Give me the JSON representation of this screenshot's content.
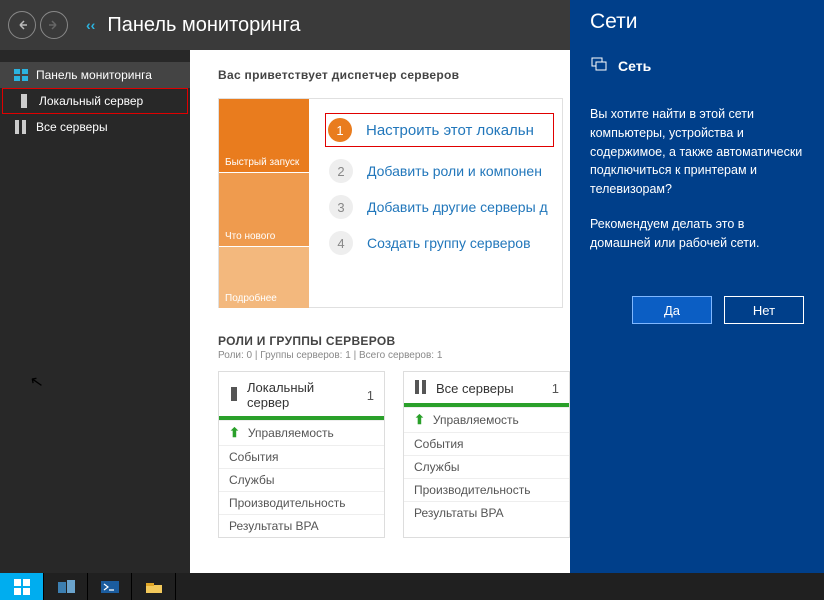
{
  "titlebar": {
    "title": "Панель мониторинга"
  },
  "sidebar": {
    "items": [
      {
        "label": "Панель мониторинга"
      },
      {
        "label": "Локальный сервер"
      },
      {
        "label": "Все серверы"
      }
    ]
  },
  "welcome": {
    "header": "Вас приветствует диспетчер серверов",
    "tabs": [
      {
        "label": "Быстрый запуск"
      },
      {
        "label": "Что нового"
      },
      {
        "label": "Подробнее"
      }
    ],
    "steps": [
      {
        "n": "1",
        "label": "Настроить этот локальн"
      },
      {
        "n": "2",
        "label": "Добавить роли и компонен"
      },
      {
        "n": "3",
        "label": "Добавить другие серверы д"
      },
      {
        "n": "4",
        "label": "Создать группу серверов"
      }
    ]
  },
  "roles": {
    "header": "РОЛИ И ГРУППЫ СЕРВЕРОВ",
    "sub": "Роли: 0 | Группы серверов: 1 | Всего серверов: 1",
    "cards": [
      {
        "title": "Локальный сервер",
        "count": "1",
        "rows": [
          "Управляемость",
          "События",
          "Службы",
          "Производительность",
          "Результаты BPA"
        ]
      },
      {
        "title": "Все серверы",
        "count": "1",
        "rows": [
          "Управляемость",
          "События",
          "Службы",
          "Производительность",
          "Результаты BPA"
        ]
      }
    ]
  },
  "networks": {
    "title": "Сети",
    "subtitle": "Сеть",
    "msg1": "Вы хотите найти в этой сети компьютеры, устройства и содержимое, а также автоматически подключиться к принтерам и телевизорам?",
    "msg2": "Рекомендуем делать это в домашней или рабочей сети.",
    "yes": "Да",
    "no": "Нет"
  }
}
